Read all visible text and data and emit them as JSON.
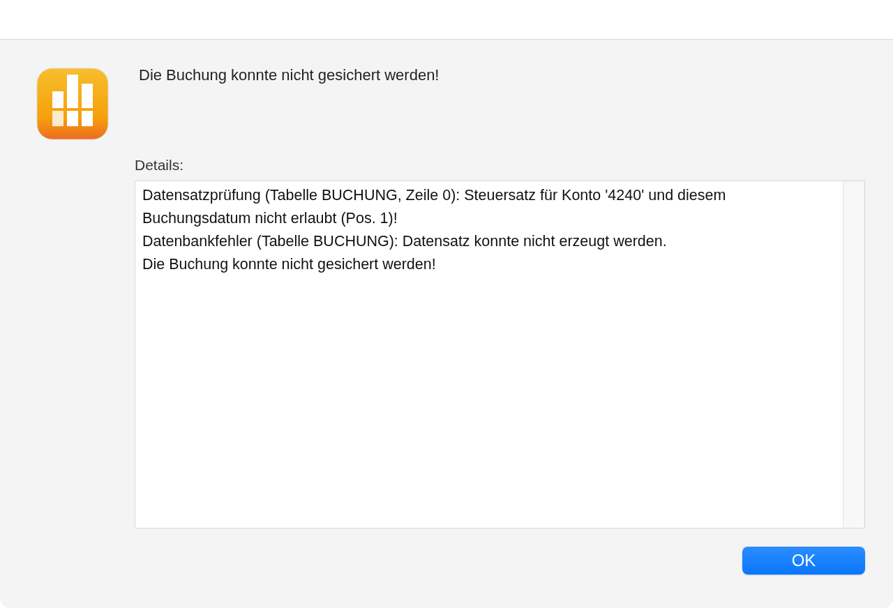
{
  "message": "Die Buchung konnte nicht gesichert werden!",
  "details": {
    "label": "Details:",
    "lines": [
      "Datensatzprüfung (Tabelle BUCHUNG, Zeile 0): Steuersatz für Konto '4240' und diesem Buchungsdatum nicht erlaubt (Pos. 1)!",
      "Datenbankfehler (Tabelle BUCHUNG): Datensatz konnte nicht erzeugt werden.",
      "Die Buchung konnte nicht gesichert werden!"
    ]
  },
  "buttons": [
    "OK"
  ]
}
